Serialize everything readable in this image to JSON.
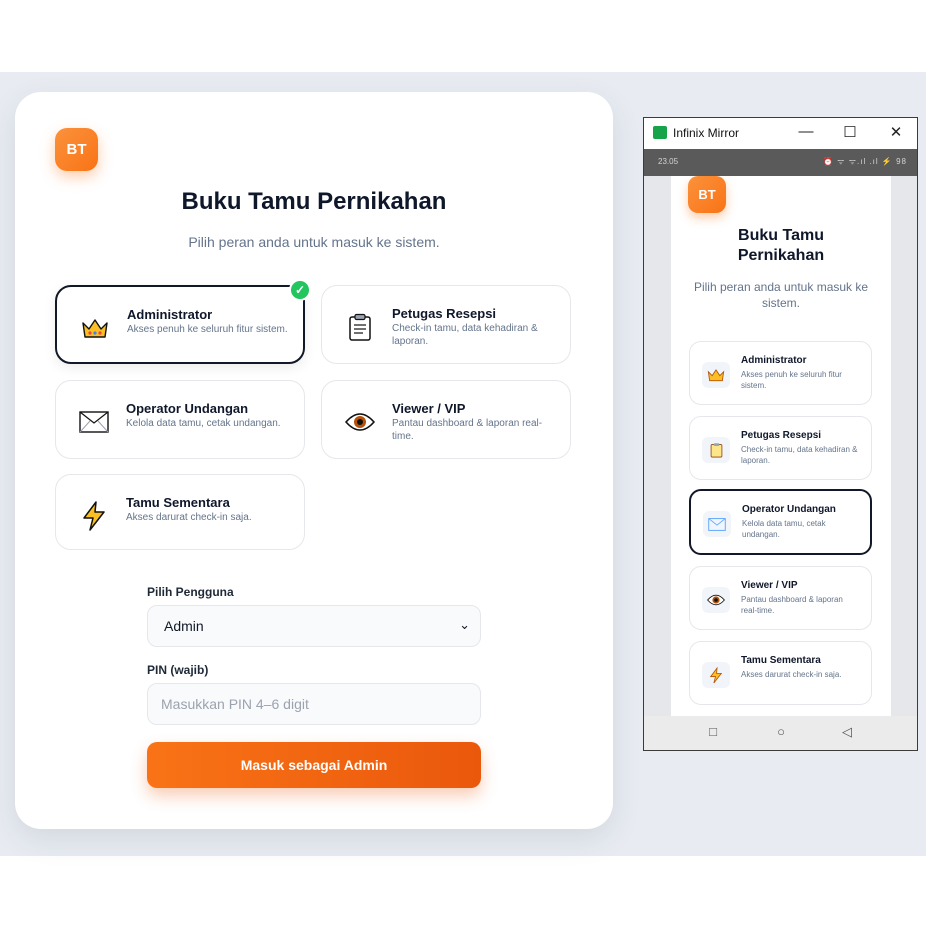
{
  "login": {
    "logo": "BT",
    "title": "Buku Tamu Pernikahan",
    "subtitle": "Pilih peran anda untuk masuk ke sistem.",
    "roles": [
      {
        "icon": "crown-icon",
        "title": "Administrator",
        "desc": "Akses penuh ke seluruh fitur sistem.",
        "selected": true
      },
      {
        "icon": "clipboard-icon",
        "title": "Petugas Resepsi",
        "desc": "Check-in tamu, data kehadiran & laporan."
      },
      {
        "icon": "envelope-icon",
        "title": "Operator Undangan",
        "desc": "Kelola data tamu, cetak undangan."
      },
      {
        "icon": "eye-icon",
        "title": "Viewer / VIP",
        "desc": "Pantau dashboard & laporan real-time."
      },
      {
        "icon": "lightning-icon",
        "title": "Tamu Sementara",
        "desc": "Akses darurat check-in saja."
      }
    ],
    "user_label": "Pilih Pengguna",
    "user_value": "Admin",
    "pin_label": "PIN (wajib)",
    "pin_placeholder": "Masukkan PIN 4–6 digit",
    "submit_label": "Masuk sebagai Admin",
    "accent": "#f97316"
  },
  "mirror": {
    "window_title": "Infinix Mirror",
    "status_time": "23.05",
    "status_icons": "⏰ ᯤ ᯤ.ıl .ıl ⚡ 98",
    "phone": {
      "logo": "BT",
      "title": "Buku Tamu Pernikahan",
      "subtitle": "Pilih peran anda untuk masuk ke sistem.",
      "roles": [
        {
          "title": "Administrator",
          "desc": "Akses penuh ke seluruh fitur sistem."
        },
        {
          "title": "Petugas Resepsi",
          "desc": "Check-in tamu, data kehadiran & laporan."
        },
        {
          "title": "Operator Undangan",
          "desc": "Kelola data tamu, cetak undangan.",
          "selected": true
        },
        {
          "title": "Viewer / VIP",
          "desc": "Pantau dashboard & laporan real-time."
        },
        {
          "title": "Tamu Sementara",
          "desc": "Akses darurat check-in saja."
        }
      ]
    }
  }
}
